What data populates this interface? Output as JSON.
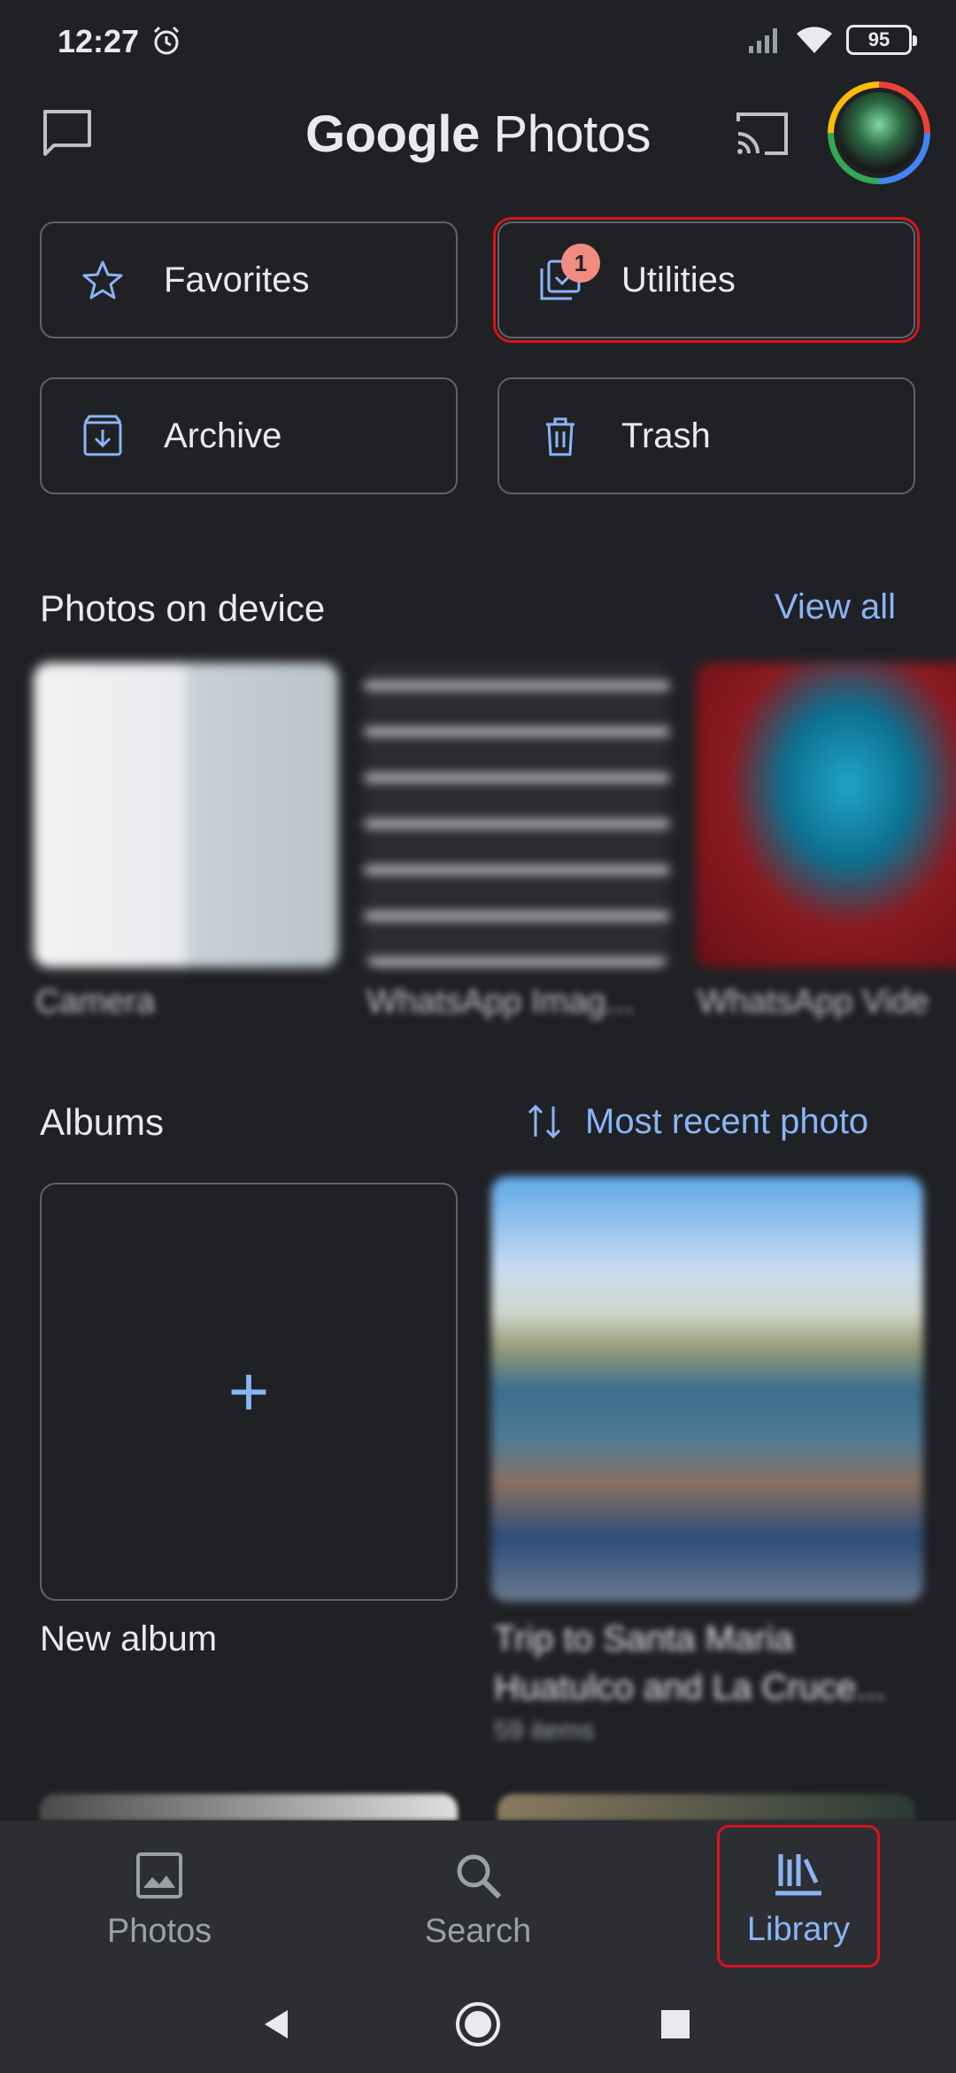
{
  "status_bar": {
    "time": "12:27",
    "battery": "95"
  },
  "app_bar": {
    "logo_google": "Google",
    "logo_photos": "Photos"
  },
  "quick_actions": [
    {
      "label": "Favorites"
    },
    {
      "label": "Utilities",
      "badge": "1"
    },
    {
      "label": "Archive"
    },
    {
      "label": "Trash"
    }
  ],
  "device_section": {
    "title": "Photos on device",
    "view_all": "View all",
    "folders": [
      {
        "label": "Camera"
      },
      {
        "label": "WhatsApp Imag..."
      },
      {
        "label": "WhatsApp Vide"
      }
    ]
  },
  "albums_section": {
    "title": "Albums",
    "sort_label": "Most recent photo",
    "new_album_label": "New album",
    "album": {
      "title_line1": "Trip to Santa Maria",
      "title_line2": "Huatulco and La Cruce...",
      "count": "59 items"
    }
  },
  "bottom_nav": {
    "photos": "Photos",
    "search": "Search",
    "library": "Library"
  },
  "colors": {
    "background": "#202124",
    "accent": "#8ab4f8",
    "badge": "#f28b82",
    "highlight": "#d7141c"
  }
}
